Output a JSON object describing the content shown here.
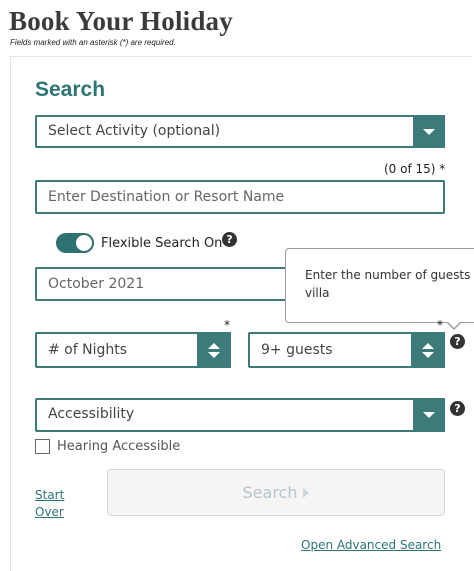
{
  "header": {
    "title": "Book Your Holiday",
    "required_note": "Fields marked with an asterisk (*) are required."
  },
  "search": {
    "heading": "Search",
    "activity_select": "Select Activity (optional)",
    "destination_count": "(0 of 15) *",
    "destination_placeholder": "Enter Destination or Resort Name",
    "flexible_toggle_label": "Flexible Search On",
    "flexible_on": true,
    "month_value": "October 2021",
    "nights_select": "# of Nights",
    "guests_select": "9+ guests",
    "required_mark": "*",
    "accessibility_select": "Accessibility",
    "hearing_label": "Hearing Accessible",
    "hearing_checked": false,
    "start_over_line1": "Start",
    "start_over_line2": "Over",
    "search_button": "Search",
    "advanced_link": "Open Advanced Search"
  },
  "tooltip": {
    "text": "Enter the number of guests villa"
  },
  "icons": {
    "help": "?"
  },
  "colors": {
    "accent": "#3d7b7b",
    "heading": "#2e7474"
  }
}
